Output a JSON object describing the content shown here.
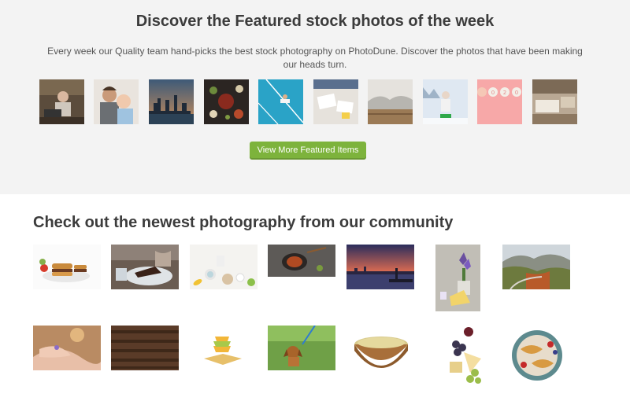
{
  "featured": {
    "title": "Discover the Featured stock photos of the week",
    "description": "Every week our Quality team hand-picks the best stock photography on PhotoDune. Discover the photos that have been making our heads turn.",
    "button_label": "View More Featured Items",
    "button_color": "#7db33c",
    "thumbnails": [
      {
        "name": "elderly-woman-laptop"
      },
      {
        "name": "father-and-baby"
      },
      {
        "name": "city-skyline-dusk"
      },
      {
        "name": "food-flat-lay-dark"
      },
      {
        "name": "tennis-court-aerial"
      },
      {
        "name": "office-desk-papers"
      },
      {
        "name": "misty-landscape"
      },
      {
        "name": "child-in-snow"
      },
      {
        "name": "2020-balloons-pink"
      },
      {
        "name": "rustic-bedroom"
      }
    ]
  },
  "community": {
    "title": "Check out the newest photography from our community",
    "photos": [
      {
        "name": "burgers-on-plate"
      },
      {
        "name": "chocolate-cake-slice"
      },
      {
        "name": "breakfast-flat-lay"
      },
      {
        "name": "dish-on-stone"
      },
      {
        "name": "sunset-pier-silhouette"
      },
      {
        "name": "cheese-and-flowers"
      },
      {
        "name": "mountain-road-autumn"
      },
      {
        "name": "hands-with-ring"
      },
      {
        "name": "wood-texture"
      },
      {
        "name": "stacked-bowls"
      },
      {
        "name": "puppy-on-grass"
      },
      {
        "name": "wooden-bowl-grain"
      },
      {
        "name": "cheese-and-grapes"
      },
      {
        "name": "croissants-on-plate"
      }
    ]
  }
}
